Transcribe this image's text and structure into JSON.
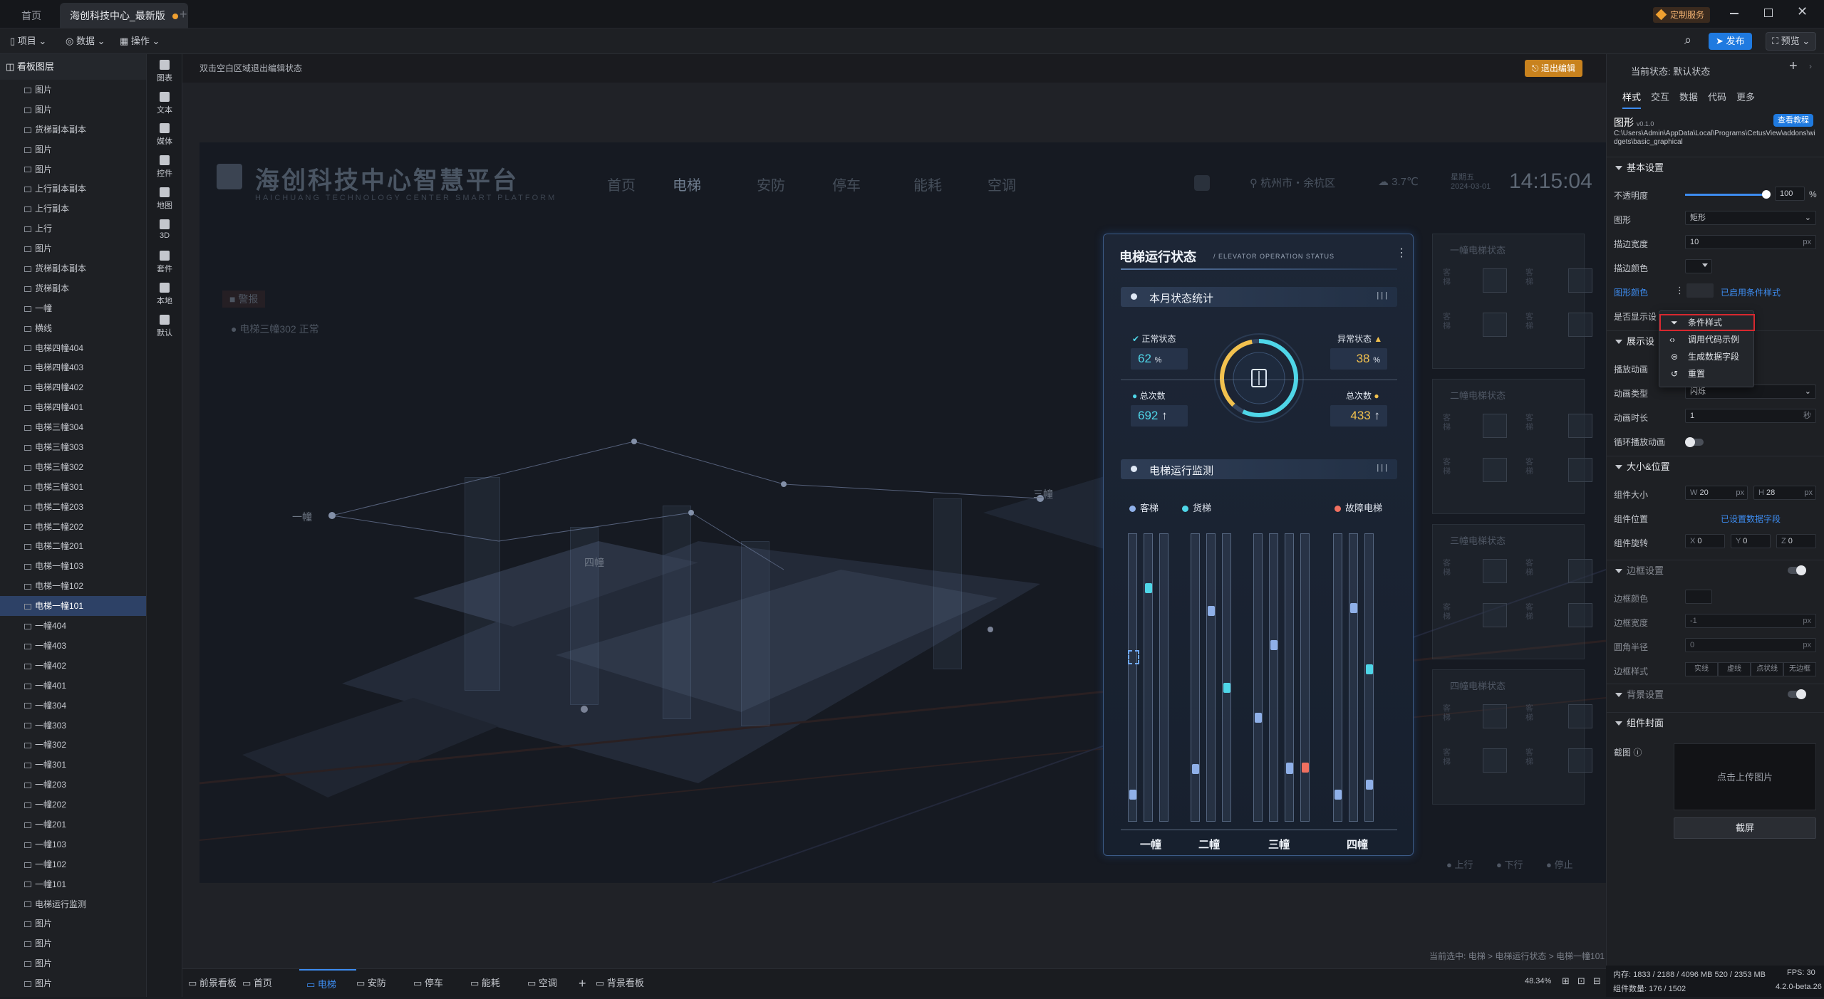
{
  "tabs": {
    "home": "首页",
    "doc": "海创科技中心_最新版",
    "service": "定制服务"
  },
  "menu": {
    "project": "项目",
    "data": "数据",
    "operate": "操作",
    "publish": "发布",
    "preview": "预览"
  },
  "layers": {
    "title": "看板图层",
    "items": [
      "图片",
      "图片",
      "货梯副本副本",
      "图片",
      "图片",
      "上行副本副本",
      "上行副本",
      "上行",
      "图片",
      "货梯副本副本",
      "货梯副本",
      "一幢",
      "横线",
      "电梯四幢404",
      "电梯四幢403",
      "电梯四幢402",
      "电梯四幢401",
      "电梯三幢304",
      "电梯三幢303",
      "电梯三幢302",
      "电梯三幢301",
      "电梯二幢203",
      "电梯二幢202",
      "电梯二幢201",
      "电梯一幢103",
      "电梯一幢102",
      "电梯一幢101",
      "一幢404",
      "一幢403",
      "一幢402",
      "一幢401",
      "一幢304",
      "一幢303",
      "一幢302",
      "一幢301",
      "一幢203",
      "一幢202",
      "一幢201",
      "一幢103",
      "一幢102",
      "一幢101",
      "电梯运行监测",
      "图片",
      "图片",
      "图片",
      "图片"
    ],
    "selected": "电梯一幢101"
  },
  "tools": [
    "图表",
    "文本",
    "媒体",
    "控件",
    "地图",
    "3D",
    "套件",
    "本地",
    "默认"
  ],
  "canvas": {
    "hint": "双击空白区域退出编辑状态",
    "exit": "退出编辑",
    "breadcrumb_prefix": "当前选中:",
    "breadcrumb": "电梯 > 电梯运行状态 > 电梯一幢101",
    "zoom": "48.34%"
  },
  "dash": {
    "title": "海创科技中心智慧平台",
    "subtitle": "HAICHUANG TECHNOLOGY CENTER SMART PLATFORM",
    "nav": [
      "首页",
      "电梯",
      "安防",
      "停车",
      "能耗",
      "空调"
    ],
    "location": "杭州市・余杭区",
    "temp": "3.7℃",
    "weekday": "星期五",
    "date": "2024-03-01",
    "time": "14:15:04",
    "alert": "警报",
    "alert_item": "电梯三幢302  正常",
    "buildings": [
      "一幢",
      "二幢",
      "三幢",
      "四幢"
    ]
  },
  "panel": {
    "title": "电梯运行状态",
    "subtitle": "ELEVATOR OPERATION STATUS",
    "sec1": "本月状态统计",
    "normal_label": "正常状态",
    "normal_val": "62",
    "abnormal_label": "异常状态",
    "abnormal_val": "38",
    "unit": "%",
    "total_label": "总次数",
    "total_left": "692",
    "total_right": "433",
    "arrow": "↑",
    "sec2": "电梯运行监测",
    "leg_passenger": "客梯",
    "leg_freight": "货梯",
    "leg_fault": "故障电梯",
    "bldgs": [
      "一幢",
      "二幢",
      "三幢",
      "四幢"
    ],
    "menu_icon": "⋮",
    "bars": "| | |"
  },
  "right_cols": {
    "titles": [
      "一幢电梯状态",
      "二幢电梯状态",
      "三幢电梯状态",
      "四幢电梯状态"
    ],
    "legend": [
      "上行",
      "下行",
      "停止"
    ],
    "box_label": "客梯"
  },
  "bottom_tabs": [
    "前景看板",
    "首页",
    "电梯",
    "安防",
    "停车",
    "能耗",
    "空调",
    "背景看板"
  ],
  "props": {
    "state_label": "当前状态:",
    "state": "默认状态",
    "tabs": [
      "样式",
      "交互",
      "数据",
      "代码",
      "更多"
    ],
    "comp_name": "图形",
    "version": "v0.1.0",
    "tutorial": "查看教程",
    "path": "C:\\Users\\Admin\\AppData\\Local\\Programs\\CetusView\\addons\\widgets\\basic_graphical",
    "basic": "基本设置",
    "opacity": "不透明度",
    "opacity_val": "100",
    "pct": "%",
    "shape": "图形",
    "shape_val": "矩形",
    "stroke_w": "描边宽度",
    "stroke_w_val": "10",
    "px": "px",
    "stroke_c": "描边颜色",
    "fill_c": "图形颜色",
    "cond_applied": "已启用条件样式",
    "show": "是否显示设",
    "anim_sec": "展示设",
    "anim_play": "播放动画",
    "anim_type": "动画类型",
    "anim_type_val": "闪烁",
    "anim_dur": "动画时长",
    "anim_dur_val": "1",
    "sec": "秒",
    "loop": "循环播放动画",
    "size_sec": "大小&位置",
    "size": "组件大小",
    "w_lbl": "W",
    "w": "20",
    "h_lbl": "H",
    "h": "28",
    "pos": "组件位置",
    "pos_val": "已设置数据字段",
    "rot": "组件旋转",
    "x_lbl": "X",
    "y_lbl": "Y",
    "z_lbl": "Z",
    "deg": "0",
    "border_sec": "边框设置",
    "border_c": "边框颜色",
    "border_w": "边框宽度",
    "border_w_val": "-1",
    "radius": "圆角半径",
    "radius_val": "0",
    "border_s": "边框样式",
    "styles": [
      "实线",
      "虚线",
      "点状线",
      "无边框"
    ],
    "bg_sec": "背景设置",
    "cover_sec": "组件封面",
    "screenshot": "截图",
    "upload": "点击上传图片",
    "capture": "截屏"
  },
  "ctx": [
    "条件样式",
    "调用代码示例",
    "生成数据字段",
    "重置"
  ],
  "status": {
    "mem": "内存: 1833 / 2188 / 4096 MB  520 / 2353 MB",
    "fps": "FPS: 30",
    "count": "组件数量: 176 / 1502",
    "ver": "4.2.0-beta.26"
  },
  "colors": {
    "accent": "#1f7ae0",
    "cyan": "#4fd6e8",
    "yellow": "#f2c14e",
    "fault": "#f07060"
  }
}
